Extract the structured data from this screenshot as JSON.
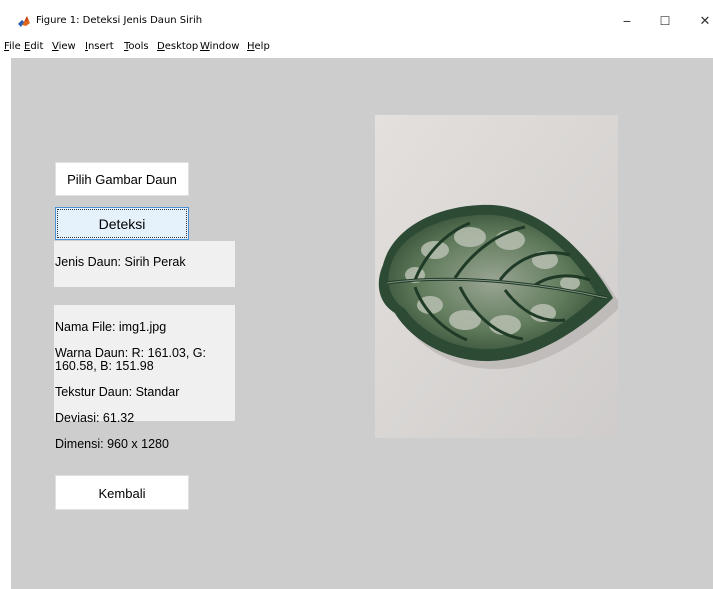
{
  "window": {
    "title": "Figure 1: Deteksi Jenis Daun Sirih",
    "controls": {
      "minimize": "−",
      "maximize": "☐",
      "close": "✕"
    }
  },
  "menu": [
    {
      "label": "File",
      "key": "F"
    },
    {
      "label": "Edit",
      "key": "E"
    },
    {
      "label": "View",
      "key": "V"
    },
    {
      "label": "Insert",
      "key": "I"
    },
    {
      "label": "Tools",
      "key": "T"
    },
    {
      "label": "Desktop",
      "key": "D"
    },
    {
      "label": "Window",
      "key": "W"
    },
    {
      "label": "Help",
      "key": "H"
    }
  ],
  "controls": {
    "pick_image_label": "Pilih Gambar Daun",
    "detect_label": "Deteksi",
    "back_label": "Kembali"
  },
  "result": {
    "leaf_type": "Jenis Daun: Sirih Perak"
  },
  "info": {
    "file_name": "Nama File: img1.jpg",
    "color": "Warna Daun: R: 161.03, G: 160.58, B: 151.98",
    "texture": "Tekstur Daun: Standar",
    "deviation": "Deviasi: 61.32",
    "dimension": "Dimensi: 960 x 1280"
  },
  "colors": {
    "figure_background": "#cdcdcd",
    "textbox_background": "#f0f0f0",
    "button_background": "#ffffff",
    "focus_border": "#4a90d9"
  },
  "icons": {
    "app": "matlab-icon",
    "image": "sirih-leaf-photo"
  }
}
